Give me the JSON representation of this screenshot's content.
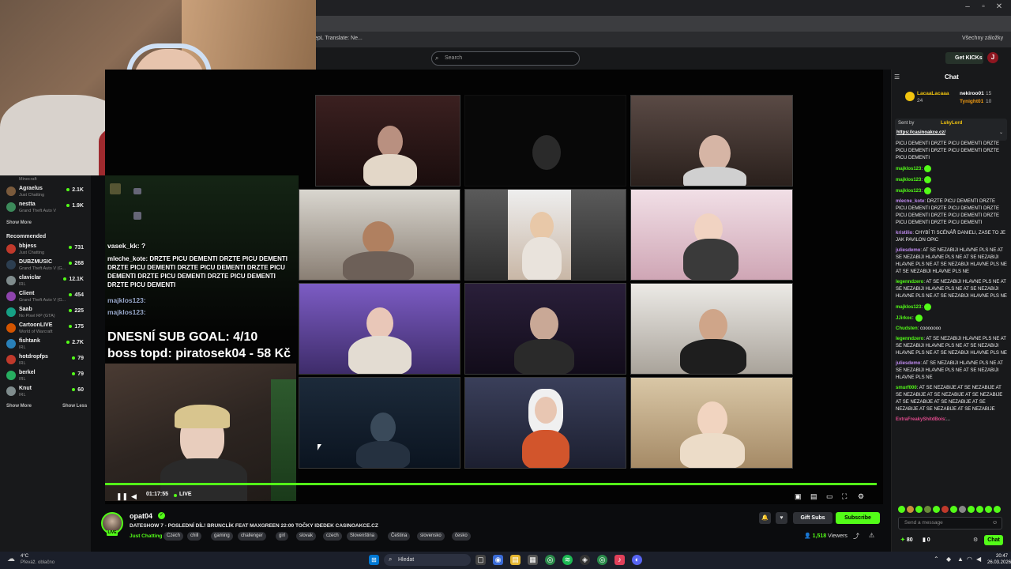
{
  "browser": {
    "bookmark_text": "epL Translate: Ne...",
    "all_bookmarks": "Všechny záložky"
  },
  "header": {
    "search_placeholder": "Search",
    "get_kicks": "Get KICKs",
    "user_initial": "J"
  },
  "sidebar": {
    "top_items": [
      {
        "name": "Minecraft",
        "category": "",
        "count": ""
      },
      {
        "name": "Agraelus",
        "category": "Just Chatting",
        "count": "2.1K"
      },
      {
        "name": "nestta",
        "category": "Grand Theft Auto V",
        "count": "1.9K"
      }
    ],
    "show_more_top": "Show More",
    "recommended_title": "Recommended",
    "recommended": [
      {
        "name": "bbjess",
        "category": "Just Chatting",
        "count": "731",
        "color": "#c0392b"
      },
      {
        "name": "DUBZMUSIC",
        "category": "Grand Theft Auto V (G...",
        "count": "268",
        "color": "#2c3e50"
      },
      {
        "name": "claviclar",
        "category": "IRL",
        "count": "12.1K",
        "color": "#7f8c8d"
      },
      {
        "name": "Client",
        "category": "Grand Theft Auto V (G...",
        "count": "454",
        "color": "#8e44ad"
      },
      {
        "name": "Saab",
        "category": "No Pixel RP (GTA)",
        "count": "225",
        "color": "#16a085"
      },
      {
        "name": "CartoonLIVE",
        "category": "World of Warcraft",
        "count": "175",
        "color": "#d35400"
      },
      {
        "name": "fishtank",
        "category": "IRL",
        "count": "2.7K",
        "color": "#2980b9"
      },
      {
        "name": "hotdropfps",
        "category": "IRL",
        "count": "79",
        "color": "#c0392b"
      },
      {
        "name": "berkel",
        "category": "IRL",
        "count": "79",
        "color": "#27ae60"
      },
      {
        "name": "Knut",
        "category": "IRL",
        "count": "60",
        "color": "#7f8c8d"
      }
    ],
    "show_more": "Show More",
    "show_less": "Show Less"
  },
  "overlay": {
    "chat_lines": [
      "vasek_kk: ?",
      "mleche_kote: DRZTE PICU DEMENTI DRZTE PICU DEMENTI",
      "DRZTE PICU DEMENTI DRZTE PICU DEMENTI DRZTE PICU",
      "DEMENTI DRZTE PICU DEMENTI DRZTE PICU DEMENTI",
      "DRZTE PICU DEMENTI",
      "majklos123:",
      "majklos123:"
    ],
    "sub_goal": "DNESNÍ SUB GOAL: 4/10",
    "boss_topd": "boss topd:  piratosek04 - 58 Kč"
  },
  "player": {
    "time": "01:17:55",
    "live": "LIVE"
  },
  "stream": {
    "channel": "opat04",
    "title": "DATESHOW 7 - POSLEDNÍ DÍL! BRUNCLÍK FEAT MAXGREEN 22:00 TOČKY IDEDEK CASINOAKCE.CZ",
    "category": "Just Chatting",
    "tags": [
      "Czech",
      "chill",
      "gaming",
      "challenger",
      "girl",
      "slovak",
      "czech",
      "Slovenština",
      "Čeština",
      "slovensko",
      "česko"
    ],
    "gift_subs": "Gift Subs",
    "subscribe": "Subscribe",
    "viewers_count": "1,518",
    "viewers_label": "Viewers",
    "live_badge": "LIVE"
  },
  "chat": {
    "title": "Chat",
    "leaderboard": [
      {
        "name": "LacaaLacaaa",
        "count": "24"
      },
      {
        "name": "nekiroo01",
        "count": "15"
      },
      {
        "name": "Tynight01",
        "count": "10"
      }
    ],
    "pinned_sender": "Sent by",
    "pinned_user": "LukyLord",
    "pinned_link": "https://casinoakce.cz/",
    "messages": [
      {
        "user": "",
        "color": "#f0f0f0",
        "text": "PICU DEMENTI DRZTE PICU DEMENTI DRZTE PICU DEMENTI DRZTE PICU DEMENTI DRZTE PICU DEMENTI"
      },
      {
        "user": "majklos123",
        "color": "#53fc18",
        "text": ":"
      },
      {
        "user": "majklos123",
        "color": "#53fc18",
        "text": ":"
      },
      {
        "user": "majklos123",
        "color": "#53fc18",
        "text": ":"
      },
      {
        "user": "mlecne_kote",
        "color": "#c08cf0",
        "text": ": DRZTE PICU DEMENTI DRZTE PICU DEMENTI DRZTE PICU DEMENTI DRZTE PICU DEMENTI DRZTE PICU DEMENTI DRZTE PICU DEMENTI DRZTE PICU DEMENTI"
      },
      {
        "user": "kristilio",
        "color": "#c08cf0",
        "text": ": CHYBÍ TI SCÉNÁŘ DANIELI, ZASE TO JE JAK PAVILON OPIC"
      },
      {
        "user": "juliesdemo",
        "color": "#c08cf0",
        "text": ": AT SE NEZABIJI HLAVNE PLS NE AT SE NEZABIJI HLAVNE PLS NE AT SE NEZABIJI HLAVNE PLS NE AT SE NEZABIJI HLAVNE PLS NE AT SE NEZABIJI HLAVNE PLS NE"
      },
      {
        "user": "legenndzero",
        "color": "#53fc18",
        "text": ": AT SE NEZABIJI HLAVNE PLS NE AT SE NEZABIJI HLAVNE PLS NE AT SE NEZABIJI HLAVNE PLS NE AT SE NEZABIJI HLAVNE PLS NE"
      },
      {
        "user": "majklos123",
        "color": "#53fc18",
        "text": ":"
      },
      {
        "user": "JJirkoc",
        "color": "#53fc18",
        "text": ":"
      },
      {
        "user": "Chudsten",
        "color": "#53fc18",
        "text": ": cooooooo"
      },
      {
        "user": "legenndzero",
        "color": "#53fc18",
        "text": ": AT SE NEZABIJI HLAVNE PLS NE AT SE NEZABIJI HLAVNE PLS NE AT SE NEZABIJI HLAVNE PLS NE AT SE NEZABIJI HLAVNE PLS NE"
      },
      {
        "user": "juliesdemo",
        "color": "#c08cf0",
        "text": ": AT SE NEZABIJI HLAVNE PLS NE AT SE NEZABIJI HLAVNE PLS NE AT SE NEZABIJI HLAVNE PLS NE"
      },
      {
        "user": "smurf000",
        "color": "#53fc18",
        "text": ": AT SE NEZABIJE AT SE NEZABIJE AT SE NEZABIJE AT SE NEZABIJE AT SE NEZABIJE AT SE NEZABIJE AT SE NEZABIJE AT SE NEZABIJE AT SE NEZABIJE AT SE NEZABIJE"
      },
      {
        "user": "ExtraFreakyShitdBois",
        "color": "#e04a8c",
        "text": ":..."
      }
    ],
    "send_placeholder": "Send a message",
    "points": "80",
    "drops": "0",
    "chat_button": "Chat"
  },
  "taskbar": {
    "temp": "4°C",
    "weather": "Převáž. oblačno",
    "search": "Hledat",
    "time": "20:47",
    "date": "26.03.2026"
  },
  "colors": {
    "accent": "#53fc18",
    "bg": "#0b0c0e",
    "panel": "#18191b"
  }
}
